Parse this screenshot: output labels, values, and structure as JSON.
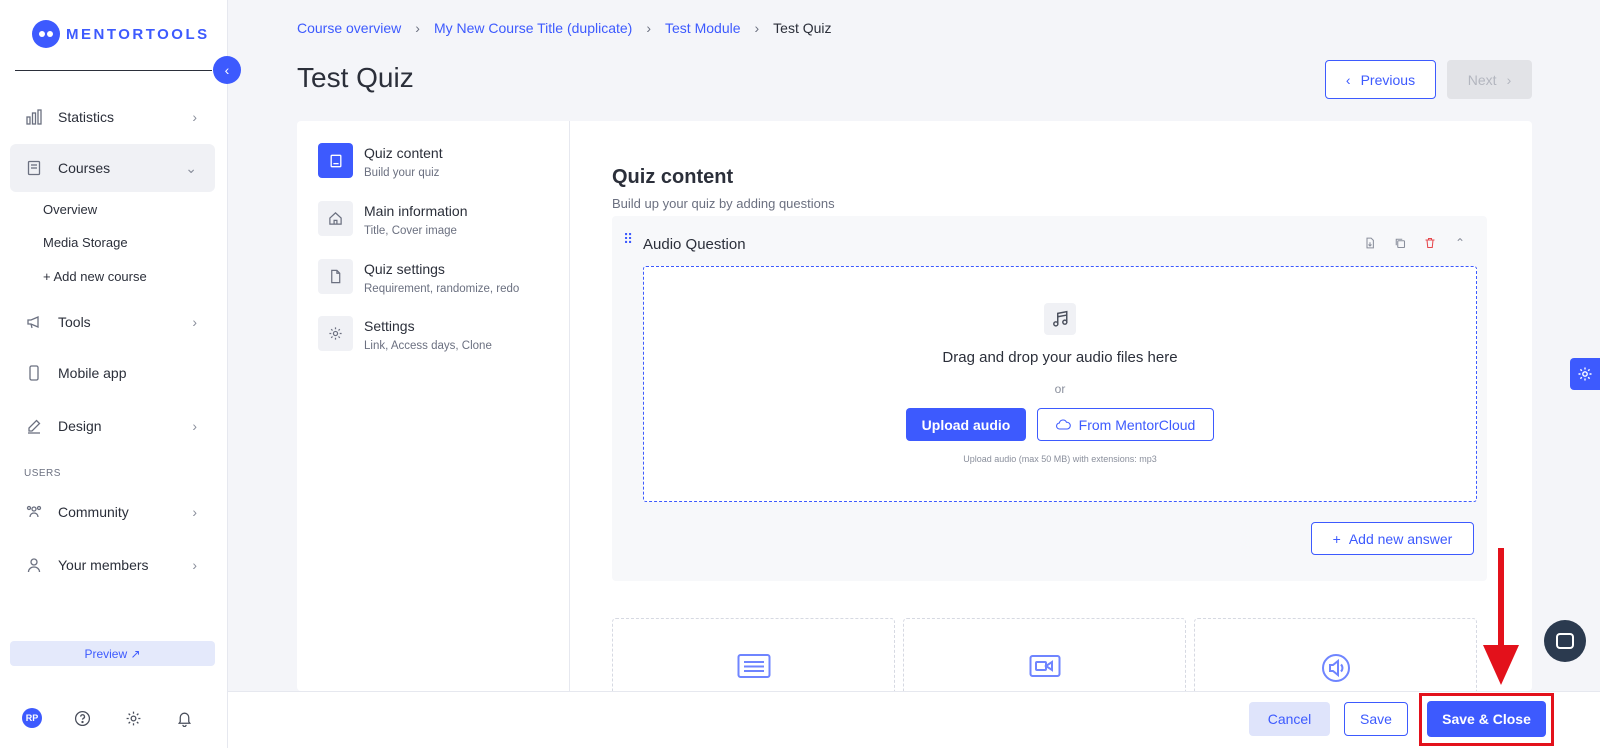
{
  "brand": {
    "name": "MENTORTOOLS"
  },
  "sidebar": {
    "items": [
      {
        "label": "Statistics"
      },
      {
        "label": "Courses"
      },
      {
        "label": "Tools"
      },
      {
        "label": "Mobile app"
      },
      {
        "label": "Design"
      },
      {
        "label": "Community"
      },
      {
        "label": "Your members"
      }
    ],
    "courses_sub": [
      "Overview",
      "Media Storage",
      "+ Add new course"
    ],
    "section_users": "USERS",
    "preview_label": "Preview ↗",
    "avatar_initials": "RP"
  },
  "breadcrumb": {
    "items": [
      "Course overview",
      "My New Course Title (duplicate)",
      "Test Module"
    ],
    "current": "Test Quiz"
  },
  "page": {
    "title": "Test Quiz",
    "prev_label": "Previous",
    "next_label": "Next"
  },
  "steps": [
    {
      "title": "Quiz content",
      "subtitle": "Build your quiz"
    },
    {
      "title": "Main information",
      "subtitle": "Title, Cover image"
    },
    {
      "title": "Quiz settings",
      "subtitle": "Requirement, randomize, redo"
    },
    {
      "title": "Settings",
      "subtitle": "Link, Access days, Clone"
    }
  ],
  "content": {
    "title": "Quiz content",
    "subtitle": "Build up your quiz by adding questions",
    "question": {
      "title": "Audio Question",
      "dropzone_title": "Drag and drop your audio files here",
      "or": "or",
      "upload_label": "Upload audio",
      "cloud_label": "From MentorCloud",
      "hint": "Upload audio (max 50 MB) with extensions: mp3",
      "add_answer_label": "Add new answer"
    }
  },
  "footer": {
    "cancel_label": "Cancel",
    "save_label": "Save",
    "save_close_label": "Save & Close"
  },
  "colors": {
    "accent": "#3d5afe",
    "highlight": "#e3111b"
  }
}
